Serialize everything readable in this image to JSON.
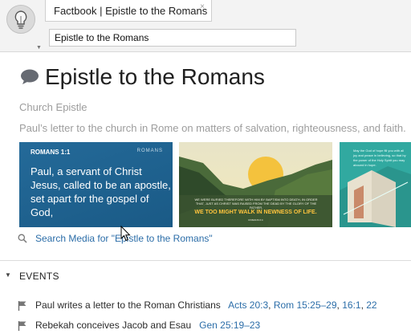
{
  "header": {
    "tab_title": "Factbook | Epistle to the Romans",
    "tab_close": "×",
    "search_value": "Epistle to the Romans"
  },
  "article": {
    "title": "Epistle to the Romans",
    "subtitle": "Church Epistle",
    "description": "Paul’s letter to the church in Rome on matters of salvation, righteousness, and faith."
  },
  "media": {
    "card1": {
      "reference": "ROMANS 1:1",
      "brand": "ROMANS",
      "verse": "Paul, a servant of Christ Jesus, called to be an apostle, set apart for the gospel of God,"
    },
    "card2": {
      "small_text": "WE WERE BURIED THEREFORE WITH HIM BY BAPTISM INTO DEATH, IN ORDER THAT, JUST AS CHRIST WAS RAISED FROM THE DEAD BY THE GLORY OF THE FATHER,",
      "big_text": "WE TOO MIGHT WALK IN NEWNESS OF LIFE.",
      "reference": "ROMANS 6:4"
    },
    "card3": {
      "text": "May the God of hope fill you with all joy and peace in believing, so that by the power of the Holy Spirit you may abound in hope."
    },
    "search_label": "Search Media for \"Epistle to the Romans\""
  },
  "events": {
    "heading": "EVENTS",
    "toggle": "▼",
    "items": [
      {
        "text": "Paul writes a letter to the Roman Christians",
        "refs": [
          "Acts 20:3",
          "Rom 15:25–29",
          "16:1",
          "22"
        ]
      },
      {
        "text": "Rebekah conceives Jacob and Esau",
        "refs": [
          "Gen 25:19–23"
        ]
      }
    ]
  },
  "icons": {
    "app": "lightbulb-icon",
    "title": "speech-bubble-icon",
    "search_media": "magnifier-icon",
    "event": "flag-icon",
    "pointer": "mouse-pointer-icon"
  },
  "colors": {
    "link": "#2b6da8",
    "muted": "#9d9d9d",
    "card_blue": "#1f6594",
    "card_teal": "#31a9a0",
    "accent_yellow": "#ffc43d"
  }
}
